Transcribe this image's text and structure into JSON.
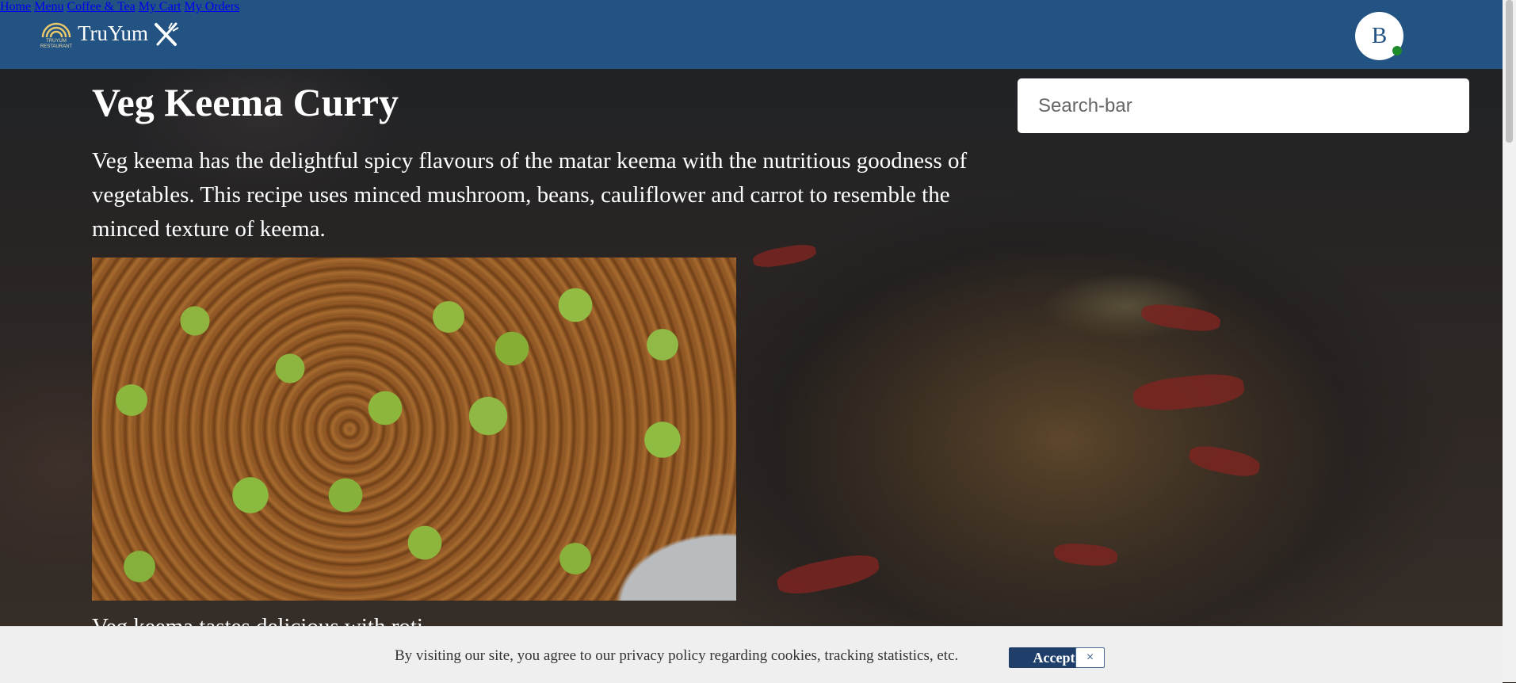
{
  "navbar": {
    "brand": "TruYum",
    "logo_small_line1": "TRUYUM",
    "logo_small_line2": "RESTAURANT",
    "links": [
      "Home",
      "Menu",
      "Coffee & Tea",
      "My Cart",
      "My Orders"
    ],
    "avatar_initial": "B",
    "icons": {
      "logo": "sun-rays-icon",
      "cutlery": "fork-knife-icon",
      "status": "online-dot-icon"
    }
  },
  "dish": {
    "title": "Veg Keema Curry",
    "description": "Veg keema has the delightful spicy flavours of the matar keema with the nutritious goodness of vegetables. This recipe uses minced mushroom, beans, cauliflower and carrot to resemble the minced texture of keema.",
    "caption": "Veg keema tastes delicious with roti"
  },
  "search": {
    "placeholder": "Search-bar",
    "value": ""
  },
  "cookie_banner": {
    "text": "By visiting our site, you agree to our privacy policy regarding cookies, tracking statistics, etc.",
    "accept_label": "Accept",
    "close_label": "×"
  },
  "colors": {
    "navbar": "#225382",
    "accept": "#1f3e69",
    "online": "#1f8a2c"
  }
}
